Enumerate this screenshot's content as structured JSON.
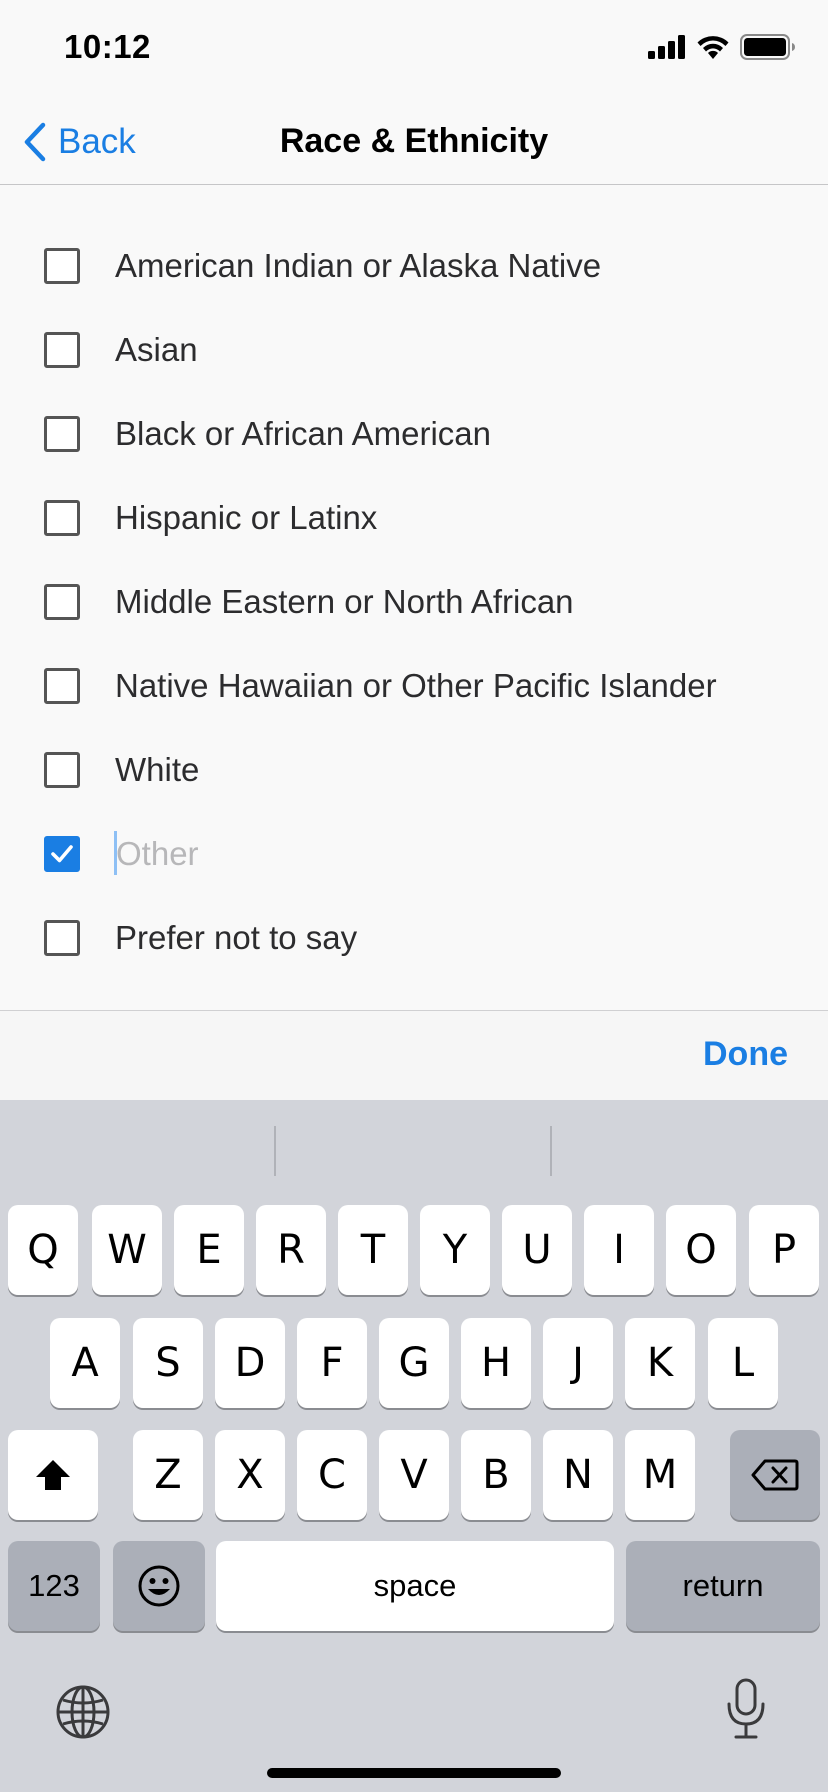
{
  "status": {
    "time": "10:12"
  },
  "nav": {
    "back_label": "Back",
    "title": "Race & Ethnicity"
  },
  "options": [
    {
      "label": "American Indian or Alaska Native",
      "checked": false
    },
    {
      "label": "Asian",
      "checked": false
    },
    {
      "label": "Black or African American",
      "checked": false
    },
    {
      "label": "Hispanic or Latinx",
      "checked": false
    },
    {
      "label": "Middle Eastern or North African",
      "checked": false
    },
    {
      "label": "Native Hawaiian or Other Pacific Islander",
      "checked": false
    },
    {
      "label": "White",
      "checked": false
    },
    {
      "label": "",
      "placeholder": "Other",
      "checked": true
    },
    {
      "label": "Prefer not to say",
      "checked": false
    }
  ],
  "accessory": {
    "done_label": "Done"
  },
  "keyboard": {
    "row1": [
      "Q",
      "W",
      "E",
      "R",
      "T",
      "Y",
      "U",
      "I",
      "O",
      "P"
    ],
    "row2": [
      "A",
      "S",
      "D",
      "F",
      "G",
      "H",
      "J",
      "K",
      "L"
    ],
    "row3": [
      "Z",
      "X",
      "C",
      "V",
      "B",
      "N",
      "M"
    ],
    "numbers_label": "123",
    "space_label": "space",
    "return_label": "return"
  },
  "colors": {
    "accent": "#1a7ee3",
    "keyboard_bg": "#d2d4da"
  }
}
